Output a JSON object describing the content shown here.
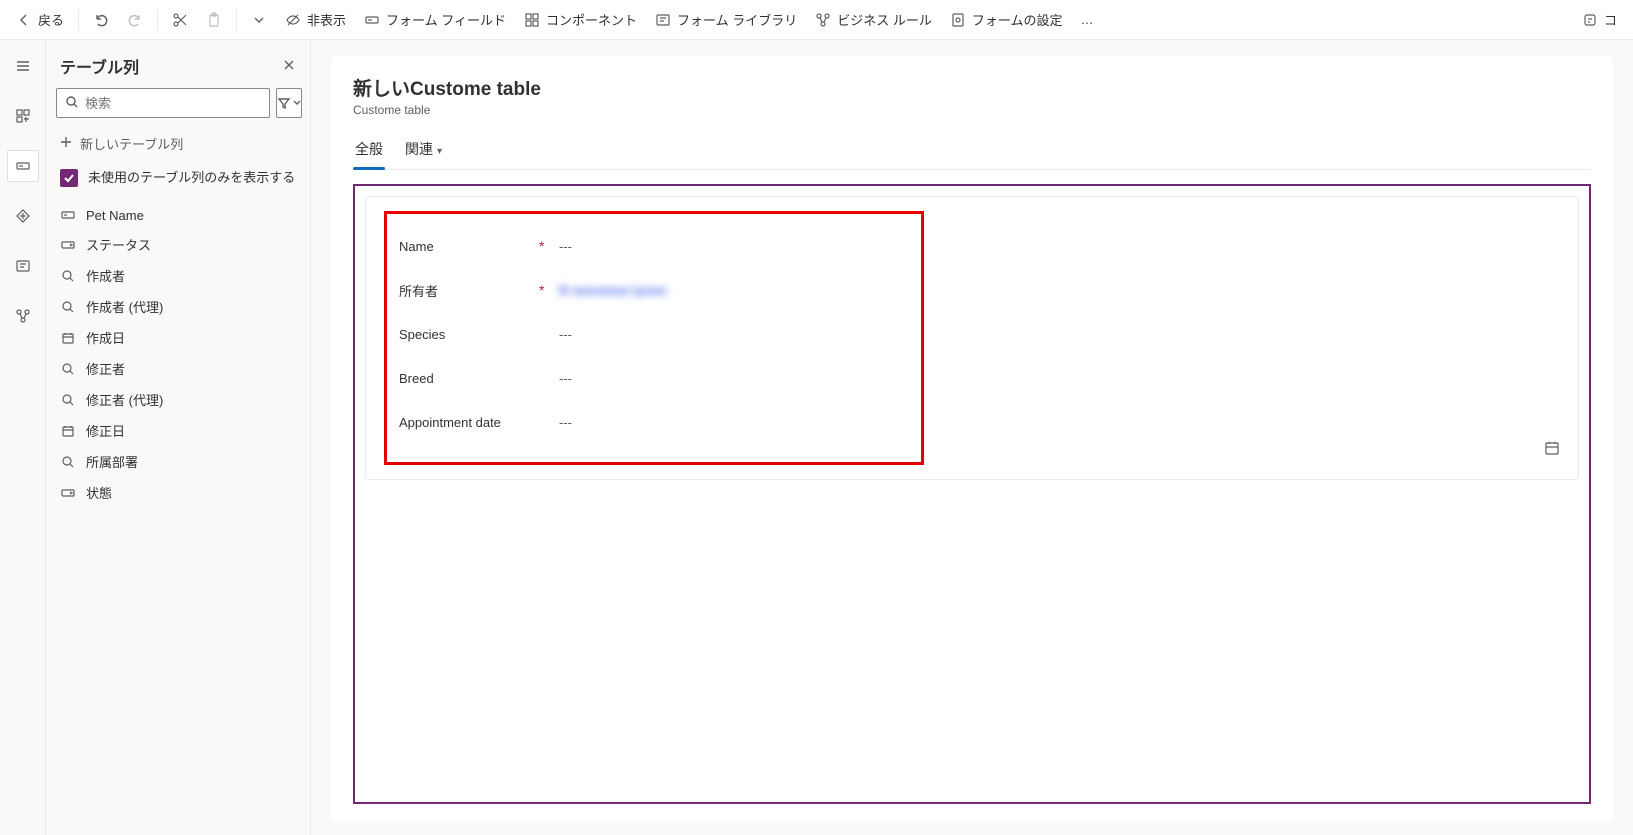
{
  "toolbar": {
    "back": "戻る",
    "hide": "非表示",
    "form_field": "フォーム フィールド",
    "component": "コンポーネント",
    "form_library": "フォーム ライブラリ",
    "business_rule": "ビジネス ルール",
    "form_settings": "フォームの設定",
    "more": "…",
    "copilot_hint": "コ"
  },
  "panel": {
    "title": "テーブル列",
    "search_placeholder": "検索",
    "add_label": "新しいテーブル列",
    "unused_only_label": "未使用のテーブル列のみを表示する",
    "columns": [
      {
        "icon": "text",
        "label": "Pet Name"
      },
      {
        "icon": "enum",
        "label": "ステータス"
      },
      {
        "icon": "lookup",
        "label": "作成者"
      },
      {
        "icon": "lookup",
        "label": "作成者 (代理)"
      },
      {
        "icon": "date",
        "label": "作成日"
      },
      {
        "icon": "lookup",
        "label": "修正者"
      },
      {
        "icon": "lookup",
        "label": "修正者 (代理)"
      },
      {
        "icon": "date",
        "label": "修正日"
      },
      {
        "icon": "lookup",
        "label": "所属部署"
      },
      {
        "icon": "enum",
        "label": "状態"
      }
    ]
  },
  "canvas": {
    "title": "新しいCustome table",
    "subtitle": "Custome table",
    "tabs": {
      "general": "全般",
      "related": "関連"
    },
    "fields": [
      {
        "label": "Name",
        "required": true,
        "value": "---",
        "type": "text"
      },
      {
        "label": "所有者",
        "required": true,
        "value": "R nennmee lynen",
        "type": "owner_blur"
      },
      {
        "label": "Species",
        "required": false,
        "value": "---",
        "type": "text"
      },
      {
        "label": "Breed",
        "required": false,
        "value": "---",
        "type": "text"
      },
      {
        "label": "Appointment date",
        "required": false,
        "value": "---",
        "type": "date"
      }
    ]
  },
  "colors": {
    "accent": "#742774",
    "highlight": "#e60000",
    "tab_active": "#0f6cbd"
  }
}
